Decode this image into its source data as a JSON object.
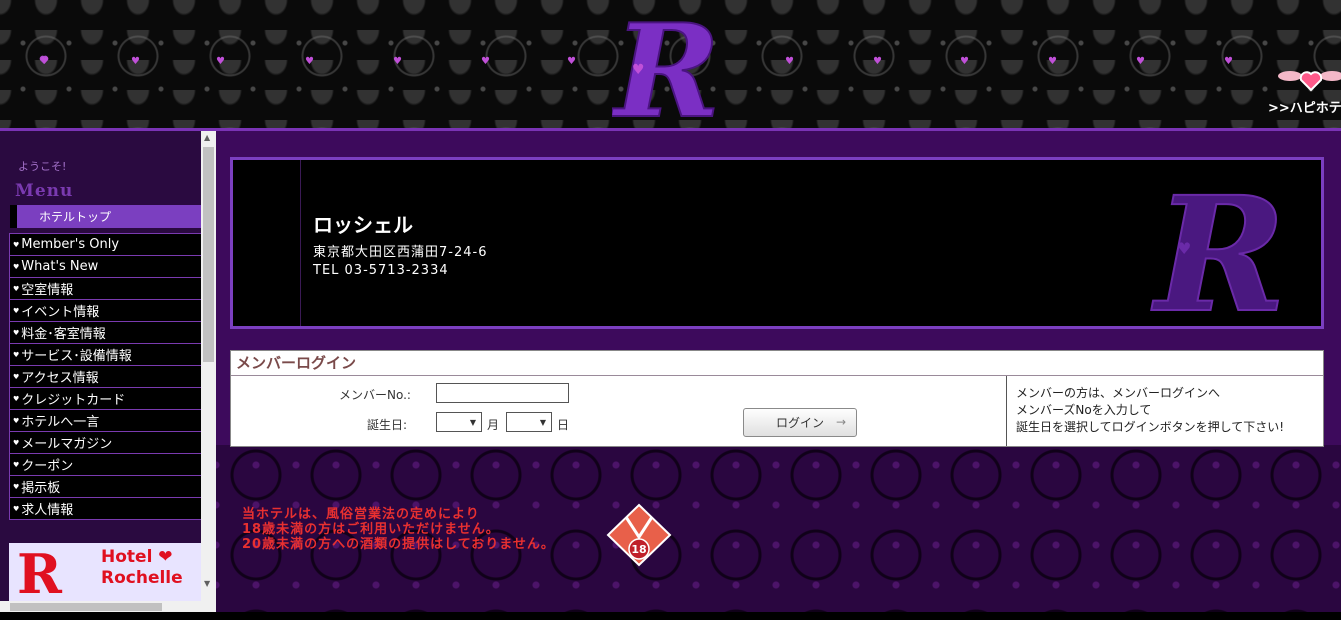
{
  "header": {
    "logo_letter": "R",
    "hapi_link": ">>ハピホテ"
  },
  "sidebar": {
    "welcome": "ようこそ!",
    "menu_title": "Menu",
    "hotel_top": "ホテルトップ",
    "items": [
      "Member's Only",
      "What's New",
      "空室情報",
      "イベント情報",
      "料金･客室情報",
      "サービス･設備情報",
      "アクセス情報",
      "クレジットカード",
      "ホテルへ一言",
      "メールマガジン",
      "クーポン",
      "掲示板",
      "求人情報"
    ],
    "banner": {
      "letter": "R",
      "line1": "Hotel ❤",
      "line2": "Rochelle"
    }
  },
  "shop": {
    "name": "ロッシェル",
    "address": "東京都大田区西蒲田7-24-6",
    "tel": "TEL 03-5713-2334",
    "logo_letter": "R"
  },
  "login": {
    "title": "メンバーログイン",
    "member_no_label": "メンバーNo.:",
    "member_no_value": "",
    "birthday_label": "誕生日:",
    "month_value": "",
    "month_unit": "月",
    "day_value": "",
    "day_unit": "日",
    "button_label": "ログイン",
    "button_arrow": "→",
    "help_lines": [
      "メンバーの方は、メンバーログインへ",
      "メンバーズNoを入力して",
      "誕生日を選択してログインボタンを押して下さい!"
    ]
  },
  "notice": {
    "lines": [
      "当ホテルは、風俗営業法の定めにより",
      "18歳未満の方はご利用いただけません。",
      "20歳未満の方への酒類の提供はしておりません。"
    ],
    "age_badge": "18"
  },
  "colors": {
    "accent_purple": "#7b3fc0",
    "main_bg": "#3d0a5c",
    "notice_red": "#e83030"
  }
}
